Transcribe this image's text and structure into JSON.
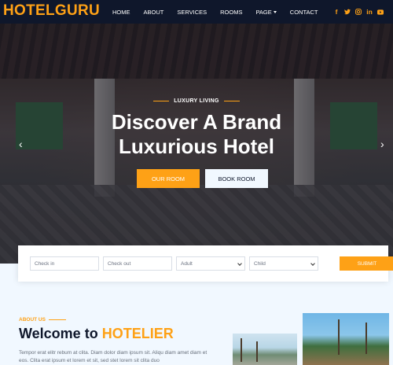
{
  "brand": "HOTELGURU",
  "nav": [
    "HOME",
    "ABOUT",
    "SERVICES",
    "ROOMS",
    "PAGE",
    "CONTACT"
  ],
  "social": [
    "facebook-icon",
    "twitter-icon",
    "instagram-icon",
    "linkedin-icon",
    "youtube-icon"
  ],
  "hero": {
    "tagline": "LUXURY LIVING",
    "title_line1": "Discover A Brand",
    "title_line2": "Luxurious Hotel",
    "btn_primary": "OUR ROOM",
    "btn_secondary": "BOOK ROOM"
  },
  "booking": {
    "checkin_placeholder": "Check in",
    "checkout_placeholder": "Check out",
    "adult_label": "Adult",
    "child_label": "Child",
    "submit_label": "SUBMIT"
  },
  "about": {
    "tag": "ABOUT US",
    "title_prefix": "Welcome to",
    "title_highlight": "HOTELIER",
    "text": "Tempor erat elitr rebum at clita. Diam dolor diam ipsum sit. Aliqu diam amet diam et eos. Clita erat ipsum et lorem et sit, sed stet lorem sit clita duo"
  },
  "colors": {
    "accent": "#fea116",
    "dark": "#0f172b",
    "light": "#f1f8ff"
  }
}
